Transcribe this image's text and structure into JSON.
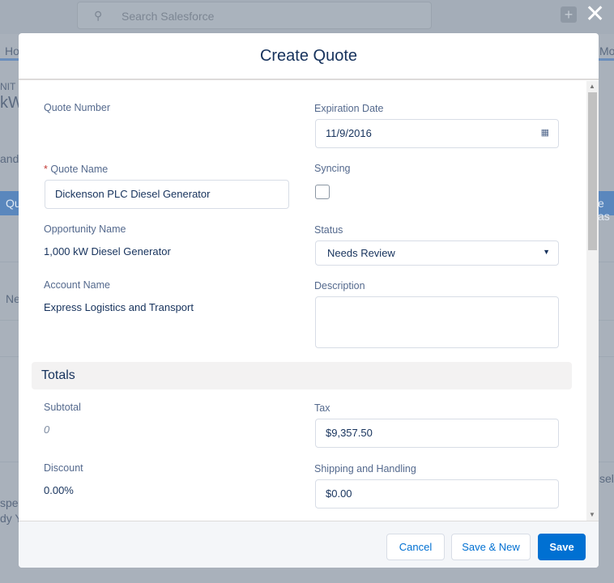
{
  "background": {
    "search_placeholder": "Search Salesforce",
    "frag_home": "Ho",
    "frag_more": "Mo",
    "frag_nit": "NIT",
    "frag_kw": "kW",
    "frag_and": "and",
    "frag_qu": "Qu",
    "frag_eas": "e as",
    "frag_ne": "Ne",
    "frag_sel": "sel",
    "frag_spec": "spec",
    "frag_dy": "dy Y"
  },
  "modal": {
    "title": "Create Quote"
  },
  "form": {
    "quote_number_label": "Quote Number",
    "expiration_date_label": "Expiration Date",
    "expiration_date_value": "11/9/2016",
    "quote_name_required": "*",
    "quote_name_label": "Quote Name",
    "quote_name_value": "Dickenson PLC Diesel Generator",
    "syncing_label": "Syncing",
    "syncing_checked": false,
    "opportunity_name_label": "Opportunity Name",
    "opportunity_name_value": "1,000 kW Diesel Generator",
    "status_label": "Status",
    "status_value": "Needs Review",
    "account_name_label": "Account Name",
    "account_name_value": "Express Logistics and Transport",
    "description_label": "Description",
    "description_value": ""
  },
  "totals": {
    "section_title": "Totals",
    "subtotal_label": "Subtotal",
    "subtotal_value": "0",
    "tax_label": "Tax",
    "tax_value": "$9,357.50",
    "discount_label": "Discount",
    "discount_value": "0.00%",
    "shipping_label": "Shipping and Handling",
    "shipping_value": "$0.00"
  },
  "footer": {
    "cancel": "Cancel",
    "save_new": "Save & New",
    "save": "Save"
  },
  "colors": {
    "brand": "#0070d2",
    "required": "#c23934"
  }
}
